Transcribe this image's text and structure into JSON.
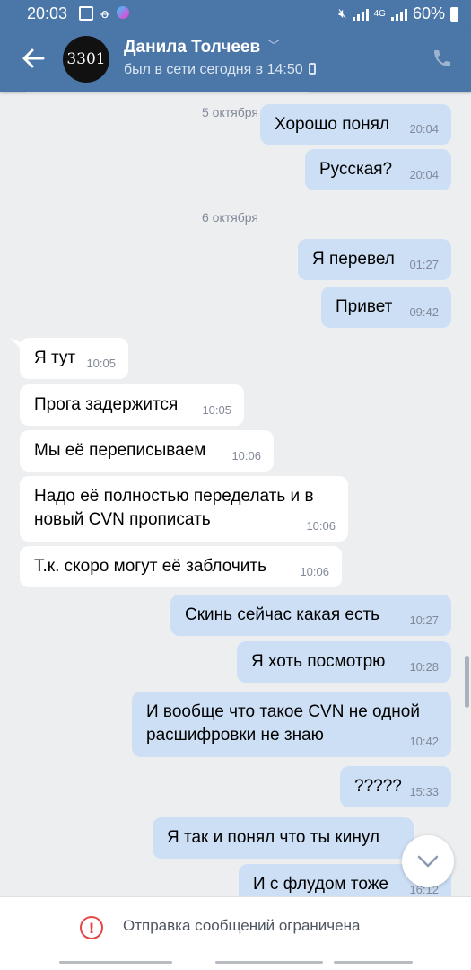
{
  "status_bar": {
    "time": "20:03",
    "battery": "60%",
    "network": "4G"
  },
  "header": {
    "contact_name": "Данила Толчеев",
    "last_seen": "был в сети сегодня в 14:50",
    "avatar_text": "3301"
  },
  "messages": [
    {
      "dir": "out",
      "text": "Хорошо понял",
      "time": "20:04"
    },
    {
      "dir": "out",
      "text": "Русская?",
      "time": "20:04"
    },
    {
      "dir": "out",
      "text": "Я перевел",
      "time": "01:27"
    },
    {
      "dir": "out",
      "text": "Привет",
      "time": "09:42"
    },
    {
      "dir": "in",
      "text": "Я тут",
      "time": "10:05"
    },
    {
      "dir": "in",
      "text": "Прога задержится",
      "time": "10:05"
    },
    {
      "dir": "in",
      "text": "Мы её переписываем",
      "time": "10:06"
    },
    {
      "dir": "in",
      "text": "Надо её полностью переделать и в новый CVN прописать",
      "time": "10:06"
    },
    {
      "dir": "in",
      "text": "Т.к. скоро могут её заблочить",
      "time": "10:06"
    },
    {
      "dir": "out",
      "text": "Скинь сейчас какая есть",
      "time": "10:27"
    },
    {
      "dir": "out",
      "text": "Я хоть посмотрю",
      "time": "10:28"
    },
    {
      "dir": "out",
      "text": "И вообще что такое CVN не одной расшифровки не знаю",
      "time": "10:42"
    },
    {
      "dir": "out",
      "text": "?????",
      "time": "15:33"
    },
    {
      "dir": "out",
      "text": "Я так и понял что ты кинул",
      "time": ""
    },
    {
      "dir": "out",
      "text": "И с флудом тоже",
      "time": "16:12"
    }
  ],
  "dates": [
    "5 октября",
    "6 октября"
  ],
  "footer": {
    "notice": "Отправка сообщений ограничена",
    "warning_glyph": "!"
  },
  "colors": {
    "header_bg": "#4a76a8",
    "outgoing_bubble": "#cddff5",
    "incoming_bubble": "#ffffff",
    "chat_bg": "#edeef0",
    "warning": "#e64646"
  }
}
